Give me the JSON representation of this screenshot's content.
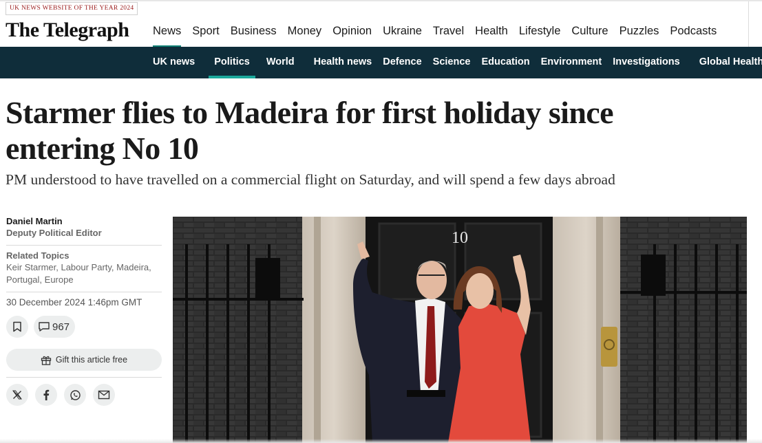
{
  "header": {
    "award_badge": "UK NEWS WEBSITE OF THE YEAR 2024",
    "logo_text": "The Telegraph",
    "main_nav": [
      {
        "label": "News",
        "active": true
      },
      {
        "label": "Sport",
        "active": false
      },
      {
        "label": "Business",
        "active": false
      },
      {
        "label": "Money",
        "active": false
      },
      {
        "label": "Opinion",
        "active": false
      },
      {
        "label": "Ukraine",
        "active": false
      },
      {
        "label": "Travel",
        "active": false
      },
      {
        "label": "Health",
        "active": false
      },
      {
        "label": "Lifestyle",
        "active": false
      },
      {
        "label": "Culture",
        "active": false
      },
      {
        "label": "Puzzles",
        "active": false
      },
      {
        "label": "Podcasts",
        "active": false
      }
    ],
    "section_nav": [
      {
        "label": "UK news",
        "active": false
      },
      {
        "label": "Politics",
        "active": true
      },
      {
        "label": "World",
        "active": false
      },
      {
        "label": "Health news",
        "active": false
      },
      {
        "label": "Defence",
        "active": false
      },
      {
        "label": "Science",
        "active": false
      },
      {
        "label": "Education",
        "active": false
      },
      {
        "label": "Environment",
        "active": false
      },
      {
        "label": "Investigations",
        "active": false
      },
      {
        "label": "Global Health Security",
        "active": false
      }
    ]
  },
  "article": {
    "headline": "Starmer flies to Madeira for first holiday since entering No 10",
    "standfirst": "PM understood to have travelled on a commercial flight on Saturday, and will spend a few days abroad",
    "author_name": "Daniel Martin",
    "author_role": "Deputy Political Editor",
    "related_topics_title": "Related Topics",
    "related_topics": "Keir Starmer, Labour Party, Madeira, Portugal, Europe",
    "published": "30 December 2024 1:46pm GMT",
    "comment_count": "967",
    "gift_label": "Gift this article free",
    "door_number": "10"
  },
  "icons": {
    "bookmark": "bookmark-icon",
    "comments": "speech-bubble-icon",
    "gift": "gift-icon",
    "x": "x-logo-icon",
    "facebook": "facebook-icon",
    "whatsapp": "whatsapp-icon",
    "email": "email-icon"
  },
  "colors": {
    "accent_teal": "#0f7f74",
    "section_bar": "#0f2d3a",
    "award_red": "#9b1c1c"
  }
}
